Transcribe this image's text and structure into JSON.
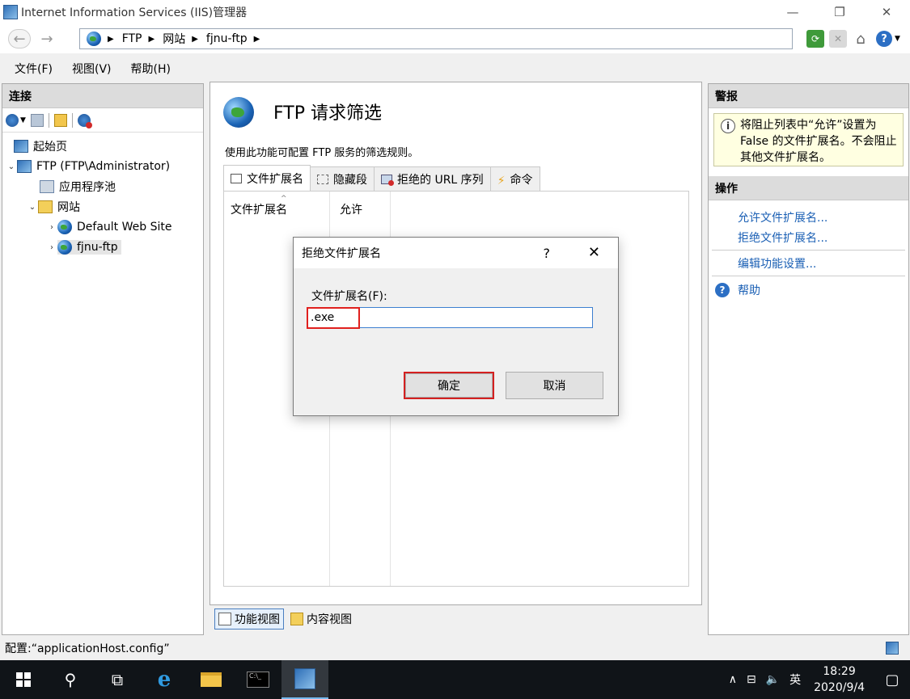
{
  "window": {
    "title": "Internet Information Services (IIS)管理器",
    "min_glyph": "—",
    "max_glyph": "❐",
    "close_glyph": "✕"
  },
  "nav": {
    "back": "←",
    "forward": "→"
  },
  "breadcrumb": [
    "FTP",
    "网站",
    "fjnu-ftp"
  ],
  "breadcrumb_sep": "▶",
  "menu": [
    "文件(F)",
    "视图(V)",
    "帮助(H)"
  ],
  "connections": {
    "header": "连接",
    "tree": [
      {
        "label": "起始页",
        "level": 0,
        "arrow": ""
      },
      {
        "label": "FTP (FTP\\Administrator)",
        "level": 0,
        "arrow": "⌄"
      },
      {
        "label": "应用程序池",
        "level": 1,
        "arrow": ""
      },
      {
        "label": "网站",
        "level": 1,
        "arrow": "⌄"
      },
      {
        "label": "Default Web Site",
        "level": 2,
        "arrow": "›"
      },
      {
        "label": "fjnu-ftp",
        "level": 2,
        "arrow": "›",
        "selected": true
      }
    ]
  },
  "feature": {
    "title": "FTP 请求筛选",
    "description": "使用此功能可配置 FTP 服务的筛选规则。",
    "tabs": [
      "文件扩展名",
      "隐藏段",
      "拒绝的 URL 序列",
      "命令"
    ],
    "active_tab": "文件扩展名",
    "columns": [
      "文件扩展名",
      "允许"
    ],
    "sort_indicator": "^"
  },
  "views": {
    "features": "功能视图",
    "content": "内容视图"
  },
  "alerts": {
    "header": "警报",
    "info_glyph": "i",
    "message": "将阻止列表中“允许”设置为 False 的文件扩展名。不会阻止其他文件扩展名。"
  },
  "actions": {
    "header": "操作",
    "allow": "允许文件扩展名...",
    "deny": "拒绝文件扩展名...",
    "edit": "编辑功能设置...",
    "help": "帮助",
    "help_glyph": "?"
  },
  "status": {
    "text": "配置:“applicationHost.config”"
  },
  "dialog": {
    "title": "拒绝文件扩展名",
    "help_glyph": "?",
    "close_glyph": "✕",
    "label": "文件扩展名(F):",
    "value": ".exe",
    "ok": "确定",
    "cancel": "取消"
  },
  "taskbar": {
    "search_glyph": "⚲",
    "taskview_glyph": "⧉",
    "ie_glyph": "e",
    "cmd_text": "C:\\_",
    "tray_up": "∧",
    "tray_net": "⊟",
    "tray_vol": "🔈",
    "ime": "英",
    "time": "18:29",
    "date": "2020/9/4",
    "notif_glyph": "▢"
  }
}
